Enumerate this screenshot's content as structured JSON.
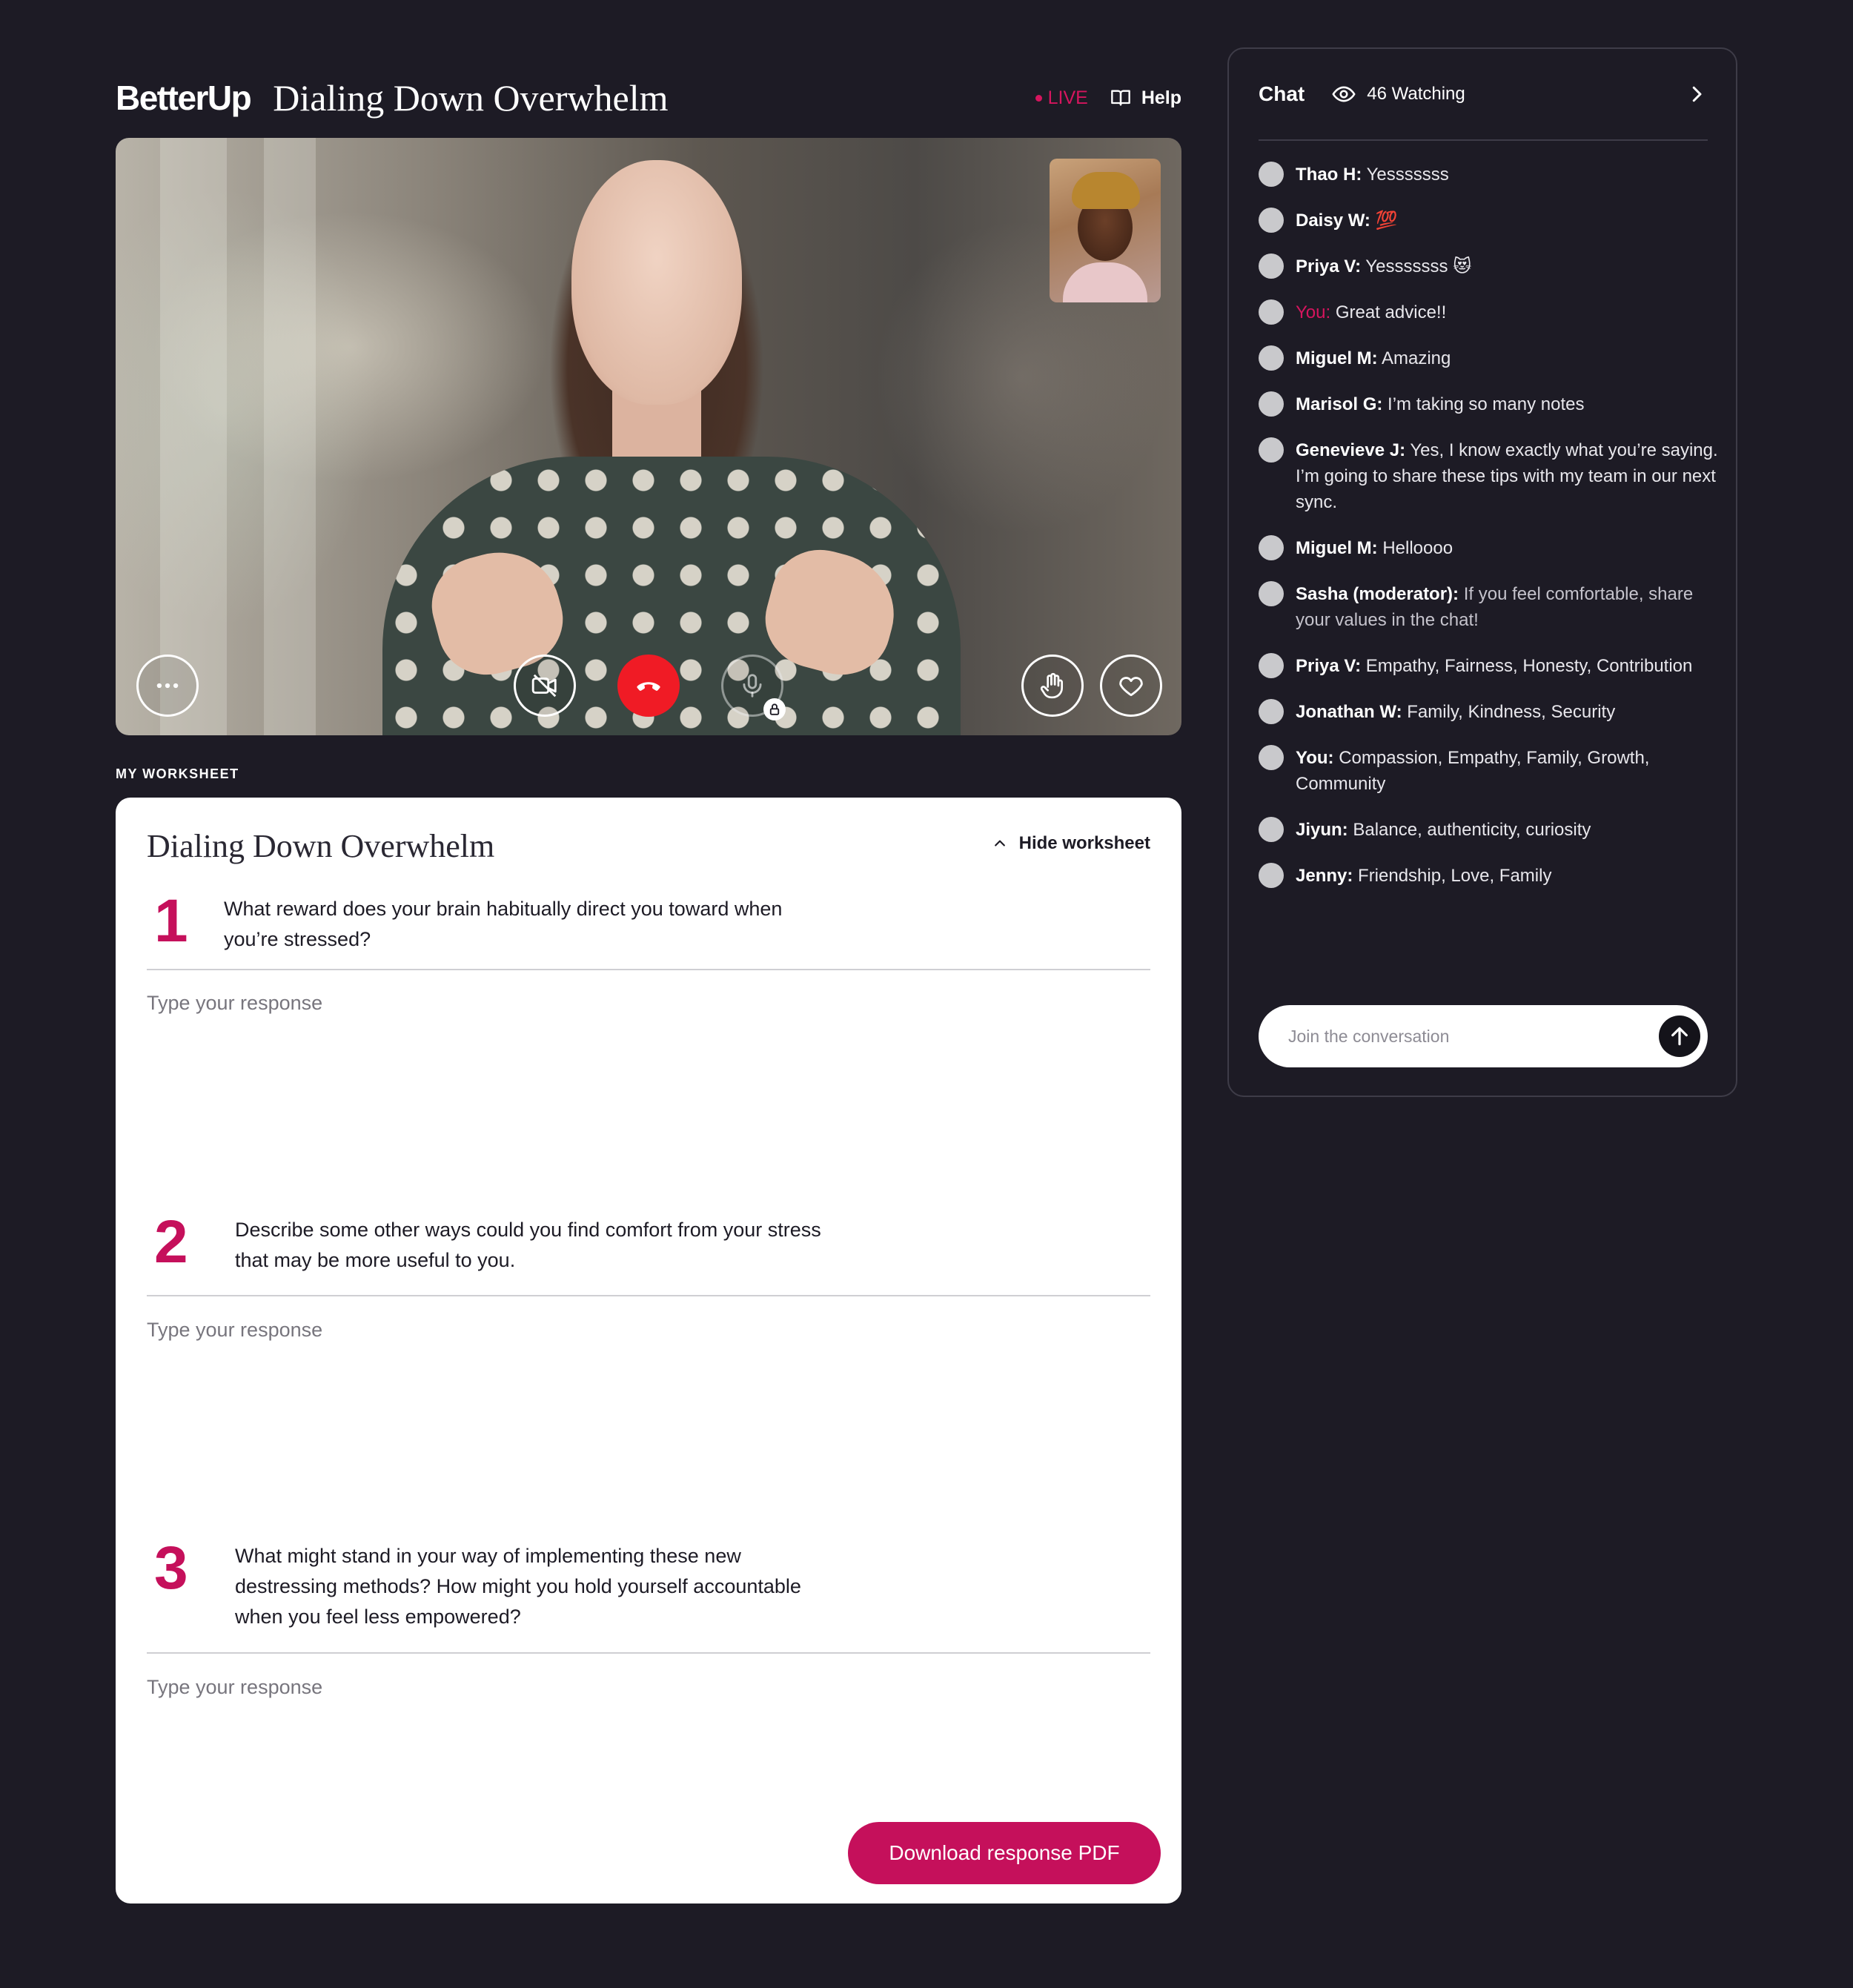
{
  "header": {
    "logo": "BetterUp",
    "title": "Dialing Down Overwhelm",
    "live_label": "LIVE",
    "help_label": "Help"
  },
  "video": {
    "controls": [
      "more-options",
      "camera-off",
      "end-call",
      "mic-locked",
      "raise-hand",
      "react-heart"
    ]
  },
  "worksheet": {
    "section_label": "MY WORKSHEET",
    "title": "Dialing Down Overwhelm",
    "hide_label": "Hide worksheet",
    "questions": [
      {
        "number": "1",
        "text": "What reward does your brain habitually direct you toward when you’re stressed?",
        "placeholder": "Type your response",
        "value": ""
      },
      {
        "number": "2",
        "text": "Describe some other ways could you find comfort from your stress that may be more useful to you.",
        "placeholder": "Type your response",
        "value": ""
      },
      {
        "number": "3",
        "text": "What might stand in your way of implementing these new destressing methods? How might you hold yourself accountable when you feel less empowered?",
        "placeholder": "Type your response",
        "value": ""
      }
    ],
    "download_label": "Download response PDF"
  },
  "chat": {
    "title": "Chat",
    "watching": "46 Watching",
    "messages": [
      {
        "name": "Thao H:",
        "text": "Yesssssss"
      },
      {
        "name": "Daisy W:",
        "text": "💯"
      },
      {
        "name": "Priya V:",
        "text": "Yesssssss 😻"
      },
      {
        "name": "You:",
        "text": "Great advice!!"
      },
      {
        "name": "Miguel M:",
        "text": "Amazing"
      },
      {
        "name": "Marisol G:",
        "text": "I’m taking so many notes"
      },
      {
        "name": "Genevieve J:",
        "text": "Yes, I know exactly what you’re saying. I’m going to share these tips with my team in our next sync."
      },
      {
        "name": "Miguel M:",
        "text": "Helloooo"
      },
      {
        "name": "Sasha (moderator):",
        "text": "If you feel comfortable, share your values in the chat!"
      },
      {
        "name": "Priya V:",
        "text": "Empathy, Fairness, Honesty, Contribution"
      },
      {
        "name": "Jonathan W:",
        "text": "Family, Kindness, Security"
      },
      {
        "name": "You:",
        "text": "Compassion, Empathy, Family, Growth, Community"
      },
      {
        "name": "Jiyun:",
        "text": "Balance, authenticity, curiosity"
      },
      {
        "name": "Jenny:",
        "text": "Friendship, Love, Family"
      }
    ],
    "input_placeholder": "Join the conversation",
    "input_value": ""
  },
  "colors": {
    "background": "#1d1b25",
    "accent": "#c5105b",
    "live": "#d6155e",
    "end_call": "#f01b25"
  }
}
